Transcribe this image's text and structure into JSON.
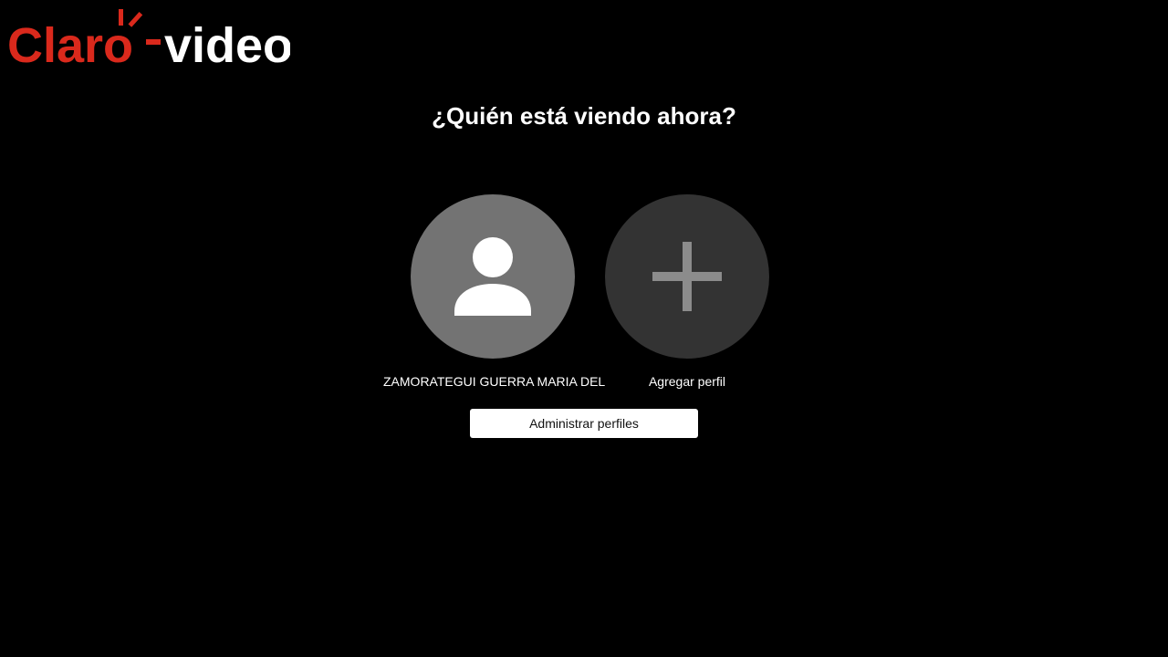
{
  "brand": {
    "name_primary": "Claro",
    "name_secondary": "video",
    "color_primary": "#DA291C",
    "color_secondary": "#FFFFFF"
  },
  "heading": "¿Quién está viendo ahora?",
  "profiles": [
    {
      "name": "ZAMORATEGUI GUERRA MARIA DEL",
      "icon": "user-icon",
      "color": "#737373"
    },
    {
      "name": "Agregar perfil",
      "icon": "plus-icon",
      "color": "#333333"
    }
  ],
  "manage_button_label": "Administrar perfiles",
  "colors": {
    "background": "#000000",
    "text": "#FFFFFF",
    "button_bg": "#FFFFFF",
    "button_text": "#111111"
  }
}
